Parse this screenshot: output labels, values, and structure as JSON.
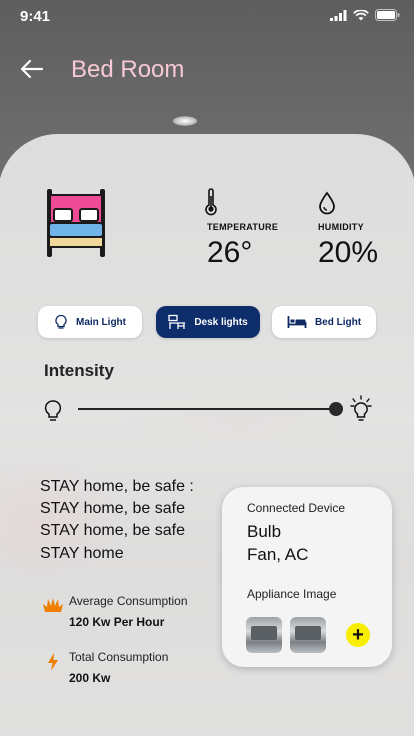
{
  "status_bar": {
    "time": "9:41"
  },
  "header": {
    "title": "Bed Room"
  },
  "metrics": {
    "temperature": {
      "label": "TEMPERATURE",
      "value": "26°"
    },
    "humidity": {
      "label": "HUMIDITY",
      "value": "20%"
    }
  },
  "light_tabs": [
    {
      "label": "Main Light",
      "active": false
    },
    {
      "label": "Desk lights",
      "active": true
    },
    {
      "label": "Bed Light",
      "active": false
    }
  ],
  "intensity": {
    "label": "Intensity",
    "level": 0.97
  },
  "messages": [
    "STAY home, be safe :",
    "STAY home, be safe",
    "STAY home, be safe",
    "STAY home"
  ],
  "consumption": {
    "average": {
      "label": "Average Consumption",
      "value": "120 Kw Per Hour"
    },
    "total": {
      "label": "Total Consumption",
      "value": "200 Kw"
    }
  },
  "device_card": {
    "title": "Connected Device",
    "devices": [
      "Bulb",
      "Fan, AC"
    ],
    "appliance_label": "Appliance Image",
    "add_symbol": "+"
  },
  "colors": {
    "accent_navy": "#0e2d6b",
    "title_pink": "#f7c9d4",
    "add_yellow": "#f7ee00",
    "bolt_orange": "#f07f00"
  }
}
